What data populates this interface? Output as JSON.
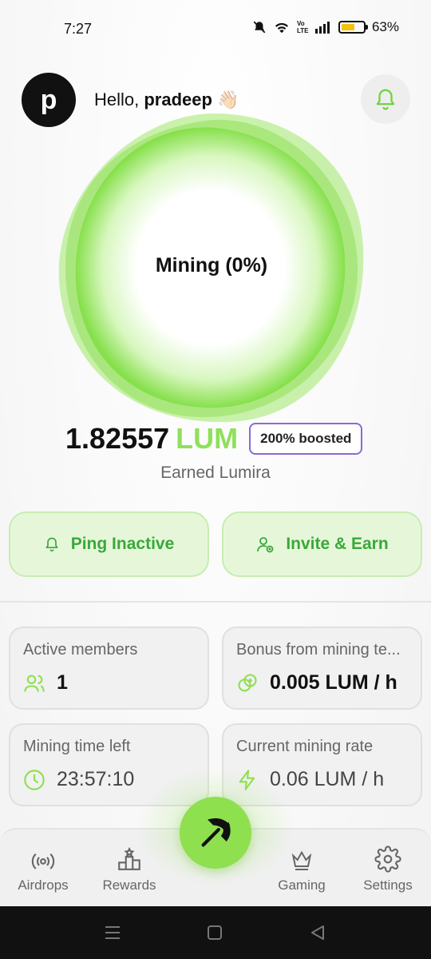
{
  "status_bar": {
    "time": "7:27",
    "battery": "63%",
    "battery_level": 0.63,
    "network": "Vo LTE"
  },
  "header": {
    "avatar_letter": "p",
    "greeting_prefix": "Hello, ",
    "username": "pradeep",
    "wave_emoji": "👋🏻"
  },
  "mining": {
    "label": "Mining (0%)",
    "progress": 0
  },
  "balance": {
    "value": "1.82557",
    "unit": "LUM",
    "boost": "200% boosted",
    "label": "Earned Lumira"
  },
  "actions": {
    "ping": "Ping Inactive",
    "invite": "Invite & Earn"
  },
  "stats": [
    {
      "title": "Active members",
      "value": "1"
    },
    {
      "title": "Bonus from mining te...",
      "value": "0.005 LUM / h"
    },
    {
      "title": "Mining time left",
      "value": "23:57:10"
    },
    {
      "title": "Current mining rate",
      "value": "0.06 LUM / h"
    }
  ],
  "nav": {
    "airdrops": "Airdrops",
    "rewards": "Rewards",
    "gaming": "Gaming",
    "settings": "Settings"
  },
  "colors": {
    "accent": "#8ee04e",
    "accent_text": "#3aa83a",
    "boost_border": "#8a6bd1"
  }
}
